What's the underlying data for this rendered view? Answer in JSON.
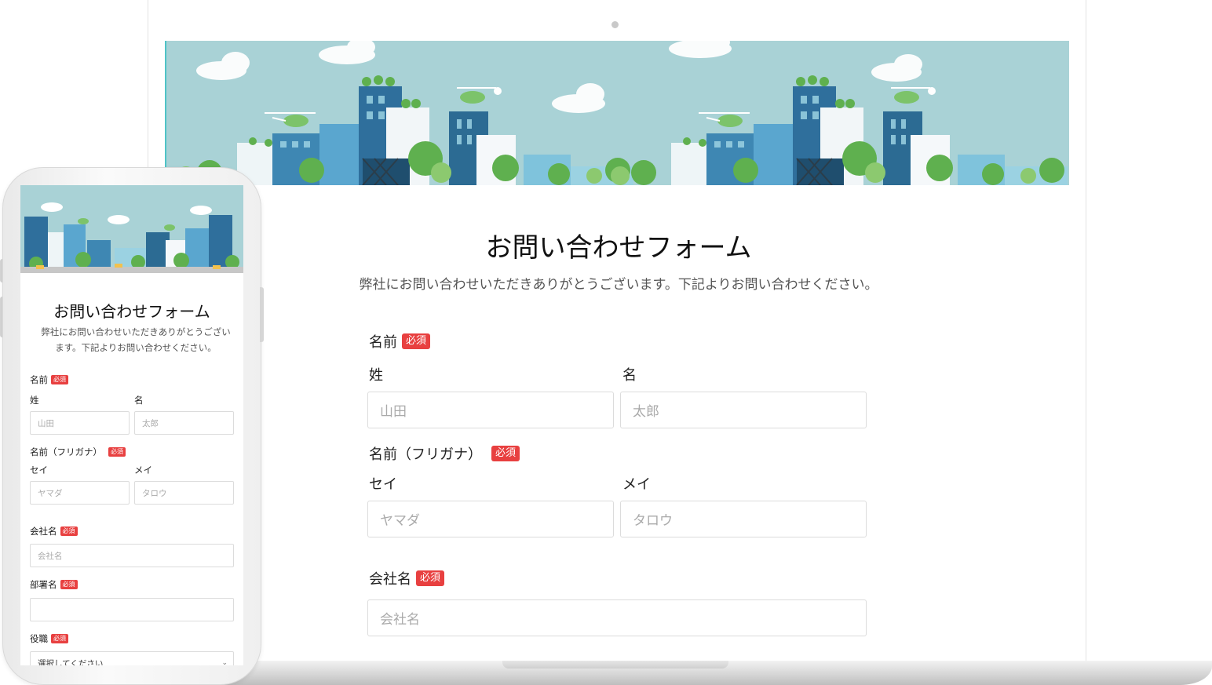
{
  "colors": {
    "required_badge": "#e84040",
    "banner_sky": "#a9d2d6",
    "accent_edge": "#4fc3c7"
  },
  "form": {
    "title": "お問い合わせフォーム",
    "description": "弊社にお問い合わせいただきありがとうございます。下記よりお問い合わせください。",
    "required_badge": "必須",
    "name": {
      "label": "名前",
      "last_label": "姓",
      "last_placeholder": "山田",
      "first_label": "名",
      "first_placeholder": "太郎"
    },
    "name_kana": {
      "label": "名前（フリガナ）",
      "last_label": "セイ",
      "last_placeholder": "ヤマダ",
      "first_label": "メイ",
      "first_placeholder": "タロウ"
    },
    "company": {
      "label": "会社名",
      "placeholder": "会社名"
    },
    "department": {
      "label": "部署名",
      "value": ""
    },
    "position": {
      "label": "役職",
      "selected": "選択してください"
    }
  },
  "phone": {
    "description_line1": "弊社にお問い合わせいただきありがとうござい",
    "description_line2": "ます。下記よりお問い合わせください。"
  }
}
